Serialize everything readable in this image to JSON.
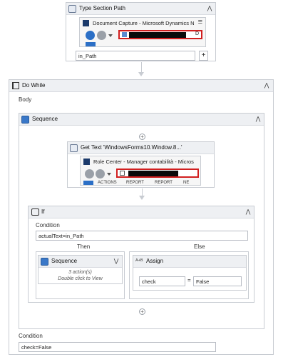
{
  "type_section": {
    "title": "Type Section Path",
    "browser_title": "Document Capture - Microsoft Dynamics N",
    "addr_tail": "D",
    "input_value": "in_Path",
    "add_symbol": "+"
  },
  "do_while": {
    "title": "Do While",
    "body_label": "Body",
    "condition_label": "Condition",
    "condition_value": "check=False"
  },
  "sequence": {
    "title": "Sequence"
  },
  "get_text": {
    "title": "Get Text 'WindowsForms10.Window.8...'",
    "browser_title": "Role Center - Manager contabilità - Micros",
    "tabs": [
      "ACTIONS",
      "REPORT",
      "REPORT",
      "NE"
    ]
  },
  "if_activity": {
    "title": "If",
    "condition_label": "Condition",
    "condition_value": "actualText=in_Path",
    "then_label": "Then",
    "else_label": "Else"
  },
  "inner_sequence": {
    "title": "Sequence",
    "actions_count": "3 action(s)",
    "hint": "Double click to View"
  },
  "assign": {
    "title": "Assign",
    "icon_text": "A+B",
    "to_value": "check",
    "equals": "=",
    "value": "False"
  },
  "glyphs": {
    "collapse": "⋀",
    "expand": "⋁",
    "plus": "+",
    "menu": "≡"
  },
  "colors": {
    "header_bg": "#eef0f3",
    "border": "#c8ccd2",
    "highlight_red": "#d11f1f",
    "nav_blue": "#2b6fc6",
    "nav_grey": "#9aa0a8"
  }
}
